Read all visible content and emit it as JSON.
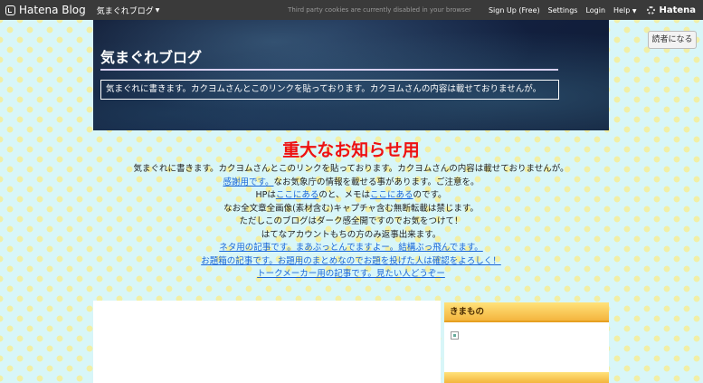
{
  "topbar": {
    "logo_text": "Hatena Blog",
    "blog_switch": "気まぐれブログ",
    "cookie_note": "Third party cookies are currently disabled in your browser",
    "signup": "Sign Up (Free)",
    "settings": "Settings",
    "login": "Login",
    "help": "Help",
    "hatena": "Hatena"
  },
  "reader_button": "読者になる",
  "header": {
    "title": "気まぐれブログ",
    "description": "気まぐれに書きます。カクヨムさんとこのリンクを貼っております。カクヨムさんの内容は載せておりませんが。"
  },
  "notice": {
    "title": "重大なお知らせ用",
    "line1": "気まぐれに書きます。カクヨムさんとこのリンクを貼っております。カクヨムさんの内容は載せておりませんが。",
    "line2_link": "感謝用です。",
    "line2_text": "なお気象庁の情報を載せる事があります。ご注意を。",
    "line3_a": "HPは",
    "line3_link1": "ここにある",
    "line3_b": "のと、メモは",
    "line3_link2": "ここにある",
    "line3_c": "のです。",
    "line4": "なお全文章全画像(素材含む)キャプチャ含む無断転載は禁じます。",
    "line5": "ただしこのブログはダーク感全開ですのでお気をつけて！",
    "line6": "はてなアカウントもちの方のみ返事出来ます。",
    "link7": "ネタ用の記事です。まあぶっとんでますよー。結構ぶっ飛んでます。",
    "link8": "お題箱の記事です。お題用のまとめなのでお題を投げた人は確認をよろしく！",
    "link9": "トークメーカー用の記事です。見たい人どうぞー"
  },
  "sidebar": {
    "module_title": "きまもの"
  }
}
